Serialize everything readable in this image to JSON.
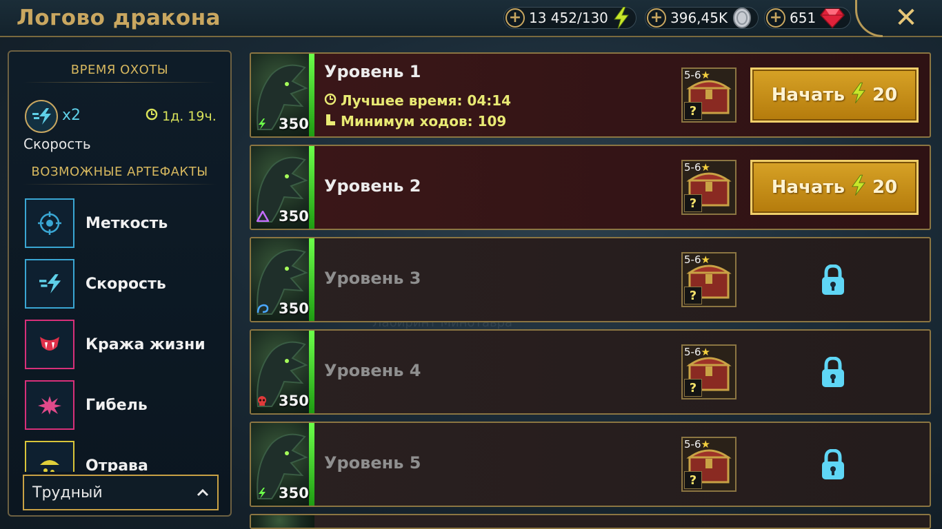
{
  "header": {
    "title": "Логово дракона",
    "energy": "13 452/130",
    "silver": "396,45K",
    "gems": "651",
    "close_label": "✕"
  },
  "sidebar": {
    "hunt_title": "ВРЕМЯ ОХОТЫ",
    "hunt_multiplier": "x2",
    "hunt_timer": "1д. 19ч.",
    "hunt_name": "Скорость",
    "artifacts_title": "ВОЗМОЖНЫЕ АРТЕФАКТЫ",
    "artifacts": [
      {
        "label": "Меткость",
        "icon": "accuracy-icon",
        "color": "#3aa7d4"
      },
      {
        "label": "Скорость",
        "icon": "speed-icon",
        "color": "#3aa7d4"
      },
      {
        "label": "Кража жизни",
        "icon": "lifesteal-icon",
        "color": "#d8307a"
      },
      {
        "label": "Гибель",
        "icon": "destroy-icon",
        "color": "#d8307a"
      },
      {
        "label": "Отрава",
        "icon": "poison-icon",
        "color": "#d9c53a"
      }
    ],
    "difficulty": "Трудный"
  },
  "levels": [
    {
      "name": "Уровень 1",
      "power": "350",
      "affinity": "force",
      "stars": "5-6",
      "best_time_label": "Лучшее время: 04:14",
      "min_turns_label": "Минимум ходов: 109",
      "start_label": "Начать",
      "cost": "20"
    },
    {
      "name": "Уровень 2",
      "power": "350",
      "affinity": "magic",
      "stars": "5-6",
      "start_label": "Начать",
      "cost": "20"
    },
    {
      "name": "Уровень 3",
      "power": "350",
      "affinity": "spirit",
      "stars": "5-6"
    },
    {
      "name": "Уровень 4",
      "power": "350",
      "affinity": "void",
      "stars": "5-6"
    },
    {
      "name": "Уровень 5",
      "power": "350",
      "affinity": "force",
      "stars": "5-6"
    }
  ],
  "reward_mark": "?"
}
